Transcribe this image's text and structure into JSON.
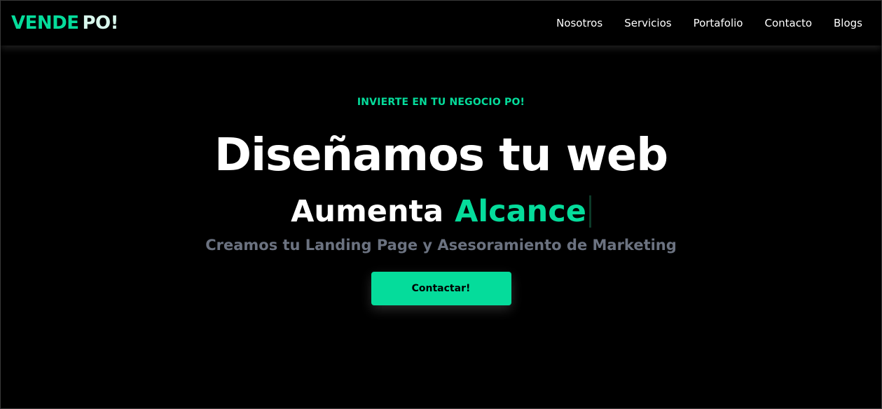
{
  "colors": {
    "background": "#000000",
    "accent": "#05dc9b",
    "brand_secondary": "#d8f7ec",
    "muted_text": "#6b7280"
  },
  "header": {
    "brand": {
      "part1": "VENDE",
      "part2": "PO!"
    },
    "nav": [
      {
        "label": "Nosotros"
      },
      {
        "label": "Servicios"
      },
      {
        "label": "Portafolio"
      },
      {
        "label": "Contacto"
      },
      {
        "label": "Blogs"
      }
    ]
  },
  "hero": {
    "eyebrow": "INVIERTE EN TU NEGOCIO PO!",
    "headline": "Diseñamos tu web",
    "rotator": {
      "static": "Aumenta",
      "dynamic": "Alcance"
    },
    "subheadline": "Creamos tu Landing Page y Asesoramiento de Marketing",
    "cta_label": "Contactar!"
  }
}
